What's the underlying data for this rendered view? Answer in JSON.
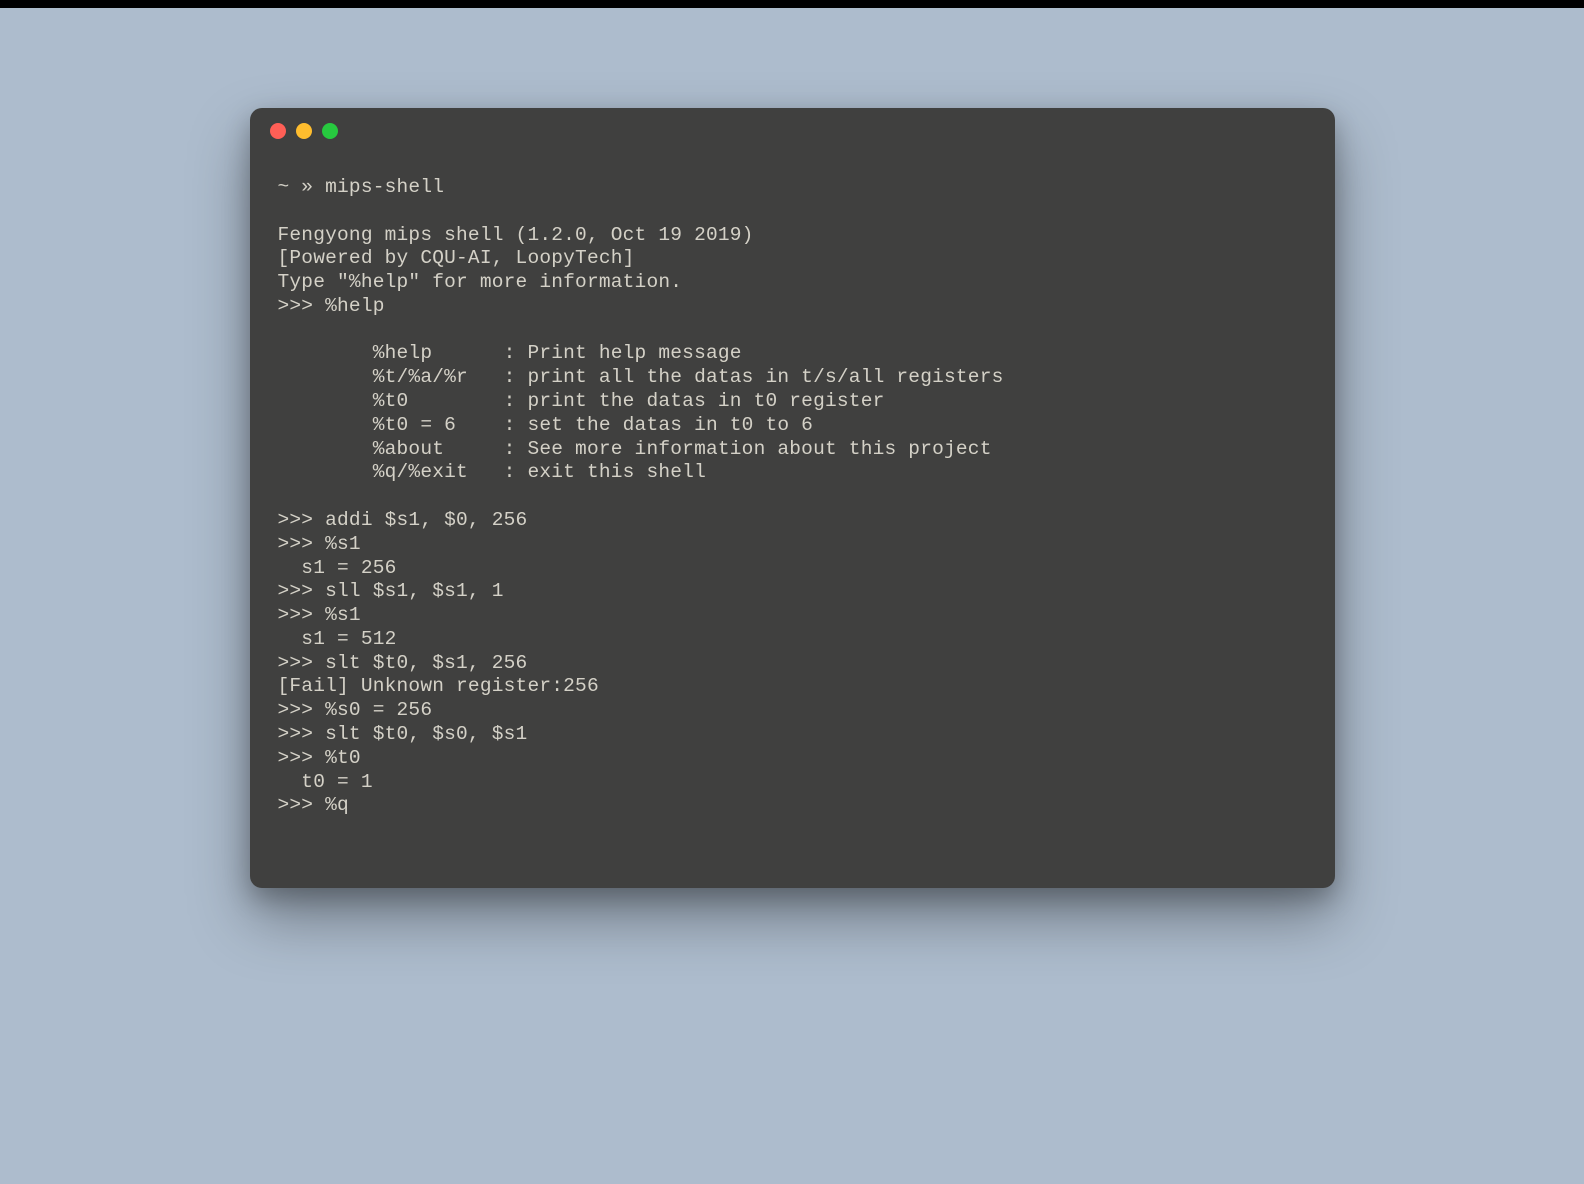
{
  "prompt_line": "~ » mips-shell",
  "banner": {
    "line1": "Fengyong mips shell (1.2.0, Oct 19 2019)",
    "line2": "[Powered by CQU-AI, LoopyTech]",
    "line3": "Type \"%help\" for more information."
  },
  "help": {
    "cmd": ">>> %help",
    "rows": [
      "        %help      : Print help message",
      "        %t/%a/%r   : print all the datas in t/s/all registers",
      "        %t0        : print the datas in t0 register",
      "        %t0 = 6    : set the datas in t0 to 6",
      "        %about     : See more information about this project",
      "        %q/%exit   : exit this shell"
    ]
  },
  "session": {
    "l1": ">>> addi $s1, $0, 256",
    "l2": ">>> %s1",
    "l3": "  s1 = 256",
    "l4": ">>> sll $s1, $s1, 1",
    "l5": ">>> %s1",
    "l6": "  s1 = 512",
    "l7": ">>> slt $t0, $s1, 256",
    "l8": "[Fail] Unknown register:256",
    "l9": ">>> %s0 = 256",
    "l10": ">>> slt $t0, $s0, $s1",
    "l11": ">>> %t0",
    "l12": "  t0 = 1",
    "l13": ">>> %q"
  }
}
